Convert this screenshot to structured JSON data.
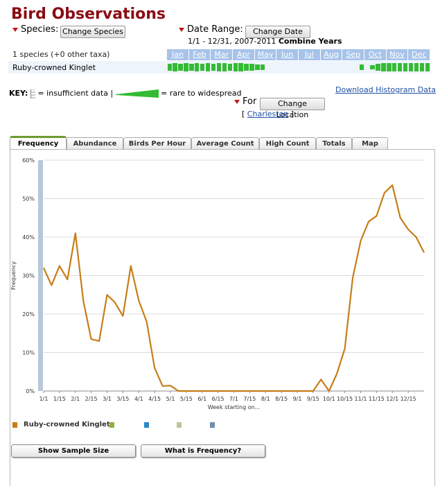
{
  "header": {
    "title": "Bird Observations",
    "species_label": "Species:",
    "change_species": "Change Species",
    "date_range_label": "Date Range:",
    "change_date": "Change Date",
    "date_range_text": "1/1 - 12/31, 2007-2011",
    "combine_years": "Combine Years",
    "species_count": "1 species (+0 other taxa)",
    "species_name": "Ruby-crowned Kinglet",
    "months": [
      "Jan",
      "Feb",
      "Mar",
      "Apr",
      "May",
      "Jun",
      "Jul",
      "Aug",
      "Sep",
      "Oct",
      "Nov",
      "Dec"
    ]
  },
  "histogram_strip": {
    "weekly_presence": [
      4,
      5,
      4,
      5,
      4,
      5,
      4,
      5,
      4,
      5,
      5,
      4,
      5,
      5,
      4,
      3,
      2,
      2,
      0,
      0,
      0,
      0,
      0,
      0,
      0,
      0,
      0,
      0,
      0,
      0,
      0,
      0,
      0,
      0,
      0,
      2,
      0,
      1,
      4,
      5,
      5,
      5,
      5,
      5,
      5,
      5,
      5,
      5
    ],
    "colors": {
      "bar": "#33bb33",
      "month_bg": "#a7c3ea"
    }
  },
  "key": {
    "label": "KEY:",
    "insufficient": "= insufficient data |",
    "rare": "= rare to widespread",
    "download": "Download Histogram Data"
  },
  "location": {
    "for_label": "For",
    "change_location": "Change Location",
    "bracket_open": "[",
    "name": "Charleston",
    "bracket_close": "]"
  },
  "tabs": [
    {
      "label": "Frequency",
      "active": true
    },
    {
      "label": "Abundance",
      "active": false
    },
    {
      "label": "Birds Per Hour",
      "active": false
    },
    {
      "label": "Average Count",
      "active": false
    },
    {
      "label": "High Count",
      "active": false
    },
    {
      "label": "Totals",
      "active": false
    },
    {
      "label": "Map",
      "active": false
    }
  ],
  "chart_data": {
    "type": "line",
    "ylabel": "Frequency",
    "xlabel": "Week starting on...",
    "ylim": [
      0,
      60
    ],
    "y_ticks": [
      "0%",
      "10%",
      "20%",
      "30%",
      "40%",
      "50%",
      "60%"
    ],
    "x_tick_labels": [
      "1/1",
      "1/15",
      "2/1",
      "2/15",
      "3/1",
      "3/15",
      "4/1",
      "4/15",
      "5/1",
      "5/15",
      "6/1",
      "6/15",
      "7/1",
      "7/15",
      "8/1",
      "8/15",
      "9/1",
      "9/15",
      "10/1",
      "10/15",
      "11/1",
      "11/15",
      "12/1",
      "12/15"
    ],
    "series": [
      {
        "name": "Ruby-crowned Kinglet",
        "color": "#c77d16",
        "values": [
          32,
          27.5,
          32.5,
          29,
          41,
          23.5,
          13.5,
          13,
          25,
          23,
          19.5,
          32.5,
          23.5,
          18,
          6,
          1.3,
          1.4,
          0,
          0,
          0,
          0,
          0,
          0,
          0,
          0,
          0,
          0,
          0,
          0,
          0,
          0,
          0,
          0,
          0,
          0,
          3,
          0,
          4.5,
          11,
          29.5,
          39,
          44,
          45.5,
          51.5,
          53.5,
          45,
          42,
          40,
          36
        ]
      }
    ],
    "grid": true,
    "legend": "bottom-left",
    "legend_colors": [
      "#c77d16",
      "#8db33a",
      "#2a87c6",
      "#c2c29a",
      "#6f8eaa"
    ]
  },
  "buttons": {
    "show_sample": "Show Sample Size",
    "what_is": "What is Frequency?"
  }
}
